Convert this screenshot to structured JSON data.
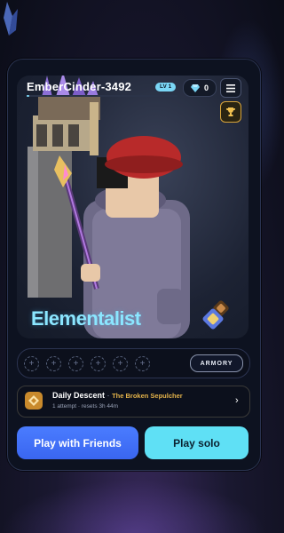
{
  "player": {
    "name": "EmberCinder-3492",
    "level_label": "LV 1",
    "xp_progress": 0.02
  },
  "currency": {
    "gems": "0"
  },
  "icons": {
    "gem": "diamond-icon",
    "menu": "menu-icon",
    "trophy": "trophy-icon",
    "class_emblem": "elementalist-emblem-icon",
    "daily": "daily-descent-icon",
    "chevron": "chevron-right-icon"
  },
  "hero": {
    "class_name": "Elementalist"
  },
  "loadout": {
    "slots": [
      "+",
      "+",
      "+",
      "+",
      "+",
      "+"
    ],
    "armory_label": "ARMORY"
  },
  "daily": {
    "title": "Daily Descent",
    "separator": "·",
    "subtitle": "The Broken Sepulcher",
    "meta": "1 attempt · resets 3h 44m",
    "chevron": "›"
  },
  "actions": {
    "friends_label": "Play with Friends",
    "solo_label": "Play solo"
  },
  "colors": {
    "accent_cyan": "#5fe0f5",
    "accent_blue": "#4a7cff",
    "gold": "#e3b24a",
    "class_text": "#8be6ff"
  }
}
